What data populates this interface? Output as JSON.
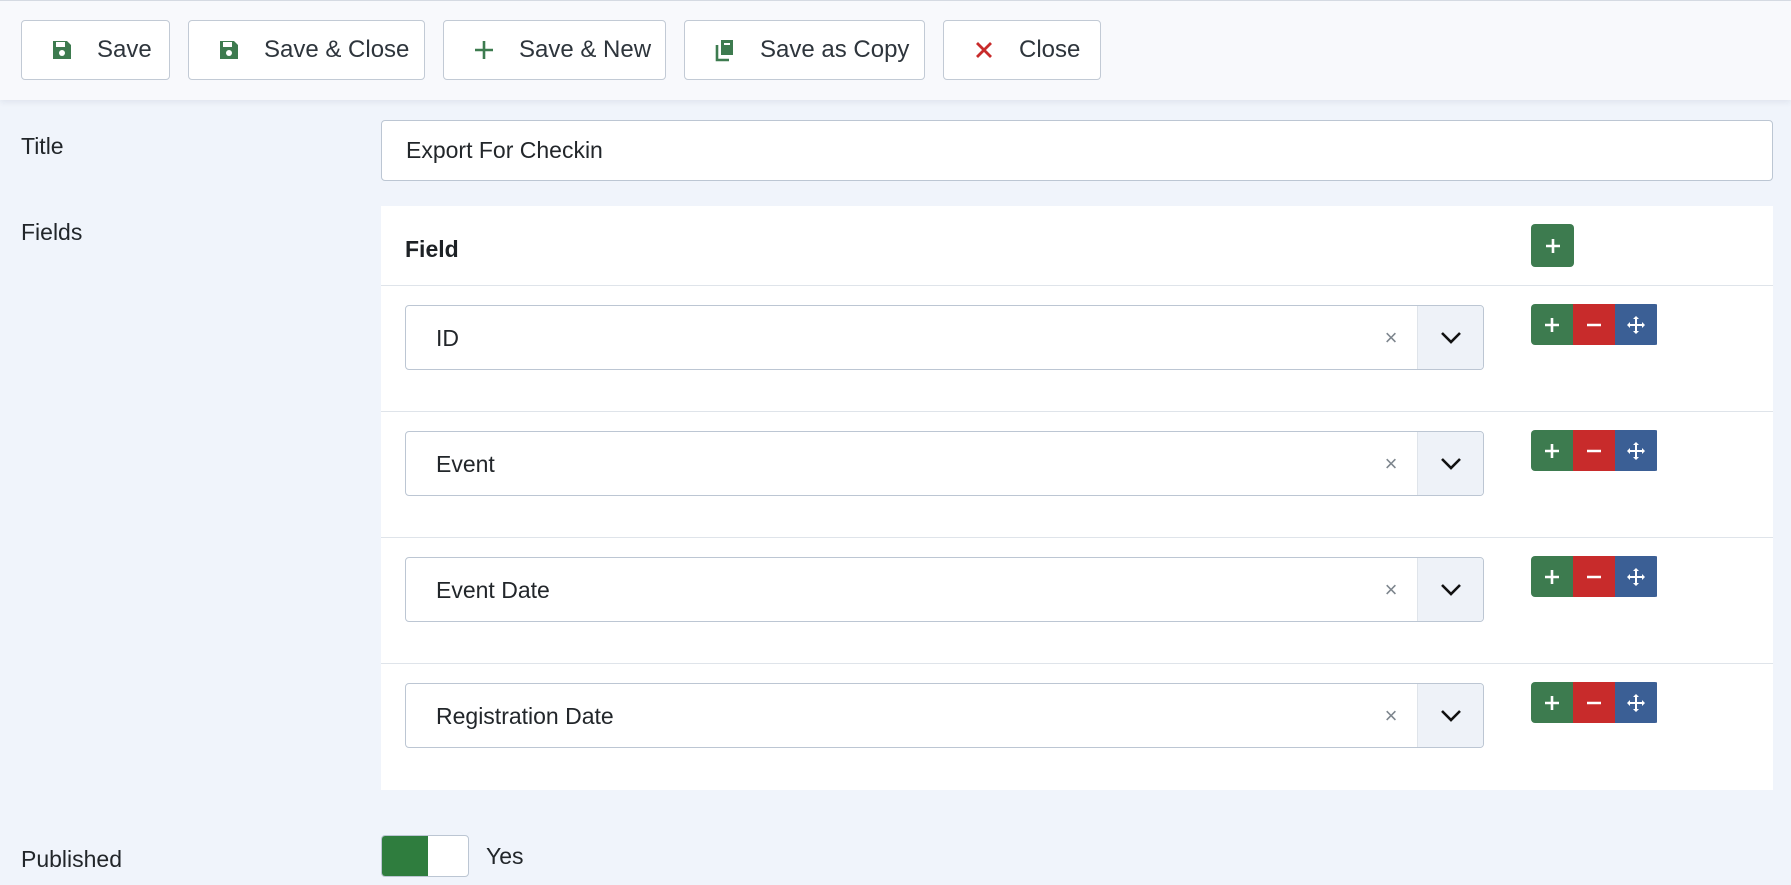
{
  "toolbar": {
    "buttons": [
      {
        "label": "Save",
        "icon": "save-icon"
      },
      {
        "label": "Save & Close",
        "icon": "save-icon"
      },
      {
        "label": "Save & New",
        "icon": "plus-icon"
      },
      {
        "label": "Save as Copy",
        "icon": "copy-icon"
      },
      {
        "label": "Close",
        "icon": "close-icon"
      }
    ]
  },
  "form": {
    "title_label": "Title",
    "title_value": "Export For Checkin",
    "fields_label": "Fields",
    "fields_header": "Field",
    "fields": [
      {
        "value": "ID"
      },
      {
        "value": "Event"
      },
      {
        "value": "Event Date"
      },
      {
        "value": "Registration Date"
      }
    ],
    "clear_glyph": "×",
    "published_label": "Published",
    "published_value": "Yes"
  },
  "colors": {
    "accent_green": "#3d7b4f",
    "danger_red": "#c82b2b",
    "move_blue": "#3b5f95",
    "toggle_green": "#2f7d3e"
  }
}
